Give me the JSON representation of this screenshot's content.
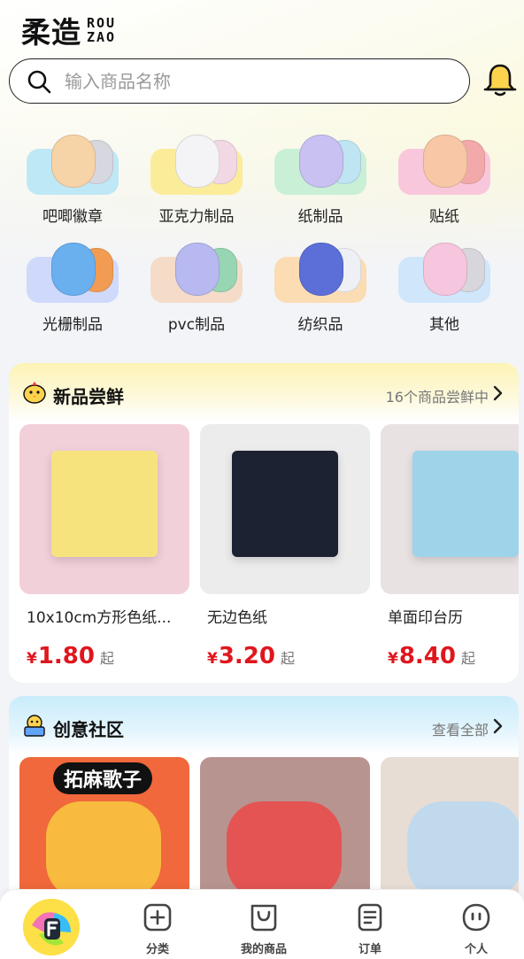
{
  "header": {
    "logo_cn": "柔造",
    "logo_en_line1": "ROU",
    "logo_en_line2": "ZAO",
    "search_placeholder": "输入商品名称",
    "search_icon": "search-icon",
    "bell_icon": "bell-icon"
  },
  "categories": [
    {
      "label": "吧唧徽章",
      "pad": "#bfe8f6",
      "fig": "#f6d4a8",
      "fig2": "#d7d7e0"
    },
    {
      "label": "亚克力制品",
      "pad": "#fbec9a",
      "fig": "#f4f4f6",
      "fig2": "#f2d7e5"
    },
    {
      "label": "纸制品",
      "pad": "#c9f0d6",
      "fig": "#c9c1f2",
      "fig2": "#bfe4f2"
    },
    {
      "label": "贴纸",
      "pad": "#f9c7dc",
      "fig": "#f7c7a6",
      "fig2": "#f3a9a9"
    },
    {
      "label": "光栅制品",
      "pad": "#cfd9fb",
      "fig": "#6ab0ef",
      "fig2": "#f19c52"
    },
    {
      "label": "pvc制品",
      "pad": "#f4dcc9",
      "fig": "#b7b9f0",
      "fig2": "#98d5b2"
    },
    {
      "label": "纺织品",
      "pad": "#fbdcb3",
      "fig": "#5c6fd8",
      "fig2": "#eef0f6"
    },
    {
      "label": "其他",
      "pad": "#cfe6fb",
      "fig": "#f6c6df",
      "fig2": "#d6d6dc"
    }
  ],
  "new_products": {
    "title": "新品尝鲜",
    "more": "16个商品尝鲜中",
    "items": [
      {
        "name": "10x10cm方形色纸...",
        "currency": "¥",
        "price": "1.80",
        "suffix": "起",
        "bg": "#f2d0da",
        "accent": "#f7e37e"
      },
      {
        "name": "无边色纸",
        "currency": "¥",
        "price": "3.20",
        "suffix": "起",
        "bg": "#ececec",
        "accent": "#1d2233"
      },
      {
        "name": "单面印台历",
        "currency": "¥",
        "price": "8.40",
        "suffix": "起",
        "bg": "#e9e2e2",
        "accent": "#9ed3ea"
      }
    ]
  },
  "community": {
    "title": "创意社区",
    "more": "查看全部",
    "items": [
      {
        "caption": "拓麻歌子",
        "bg": "#f0683b",
        "accent": "#f8c440"
      },
      {
        "caption": "",
        "bg": "#b89490",
        "accent": "#e84c4c"
      },
      {
        "caption": "",
        "bg": "#e7ddd5",
        "accent": "#bcd8f0"
      }
    ]
  },
  "tabbar": {
    "items": [
      {
        "label": "分类",
        "icon": "category-plus-icon"
      },
      {
        "label": "我的商品",
        "icon": "bag-icon"
      },
      {
        "label": "订单",
        "icon": "order-list-icon"
      },
      {
        "label": "个人",
        "icon": "profile-face-icon"
      }
    ],
    "home_icon": "brand-home-icon"
  },
  "colors": {
    "price_red": "#e0161d",
    "brand_yellow": "#fde047"
  }
}
